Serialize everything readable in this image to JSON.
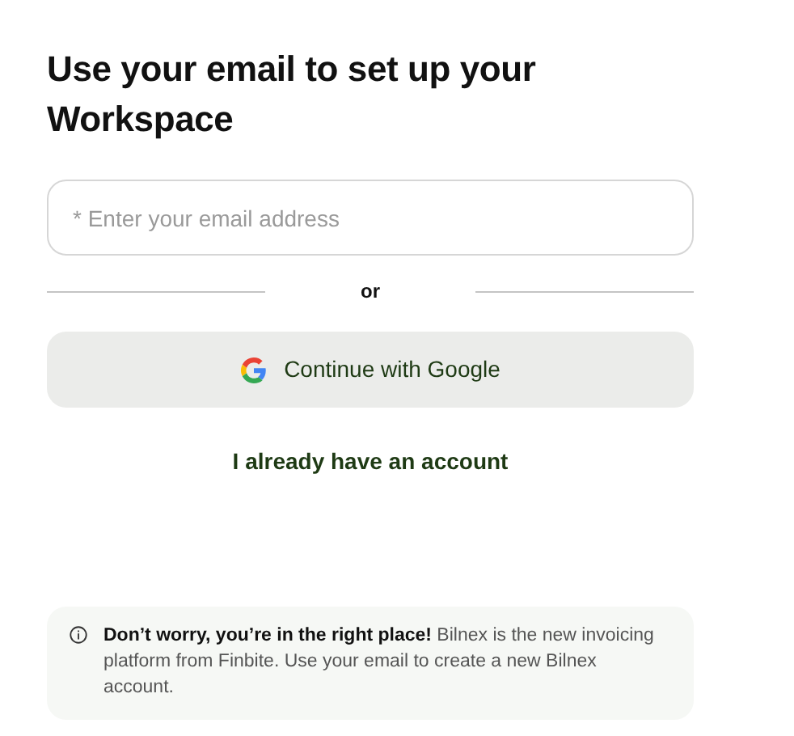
{
  "heading": "Use your email to set up your Workspace",
  "email_field": {
    "placeholder": "* Enter your email address"
  },
  "divider_label": "or",
  "google_button": {
    "label": "Continue with Google"
  },
  "login_link": "I already have an account",
  "notice": "**Don’t worry, you’re in the right place!** Bilnex is the new invoicing platform from Finbite. Use your email to create a new Bilnex account."
}
